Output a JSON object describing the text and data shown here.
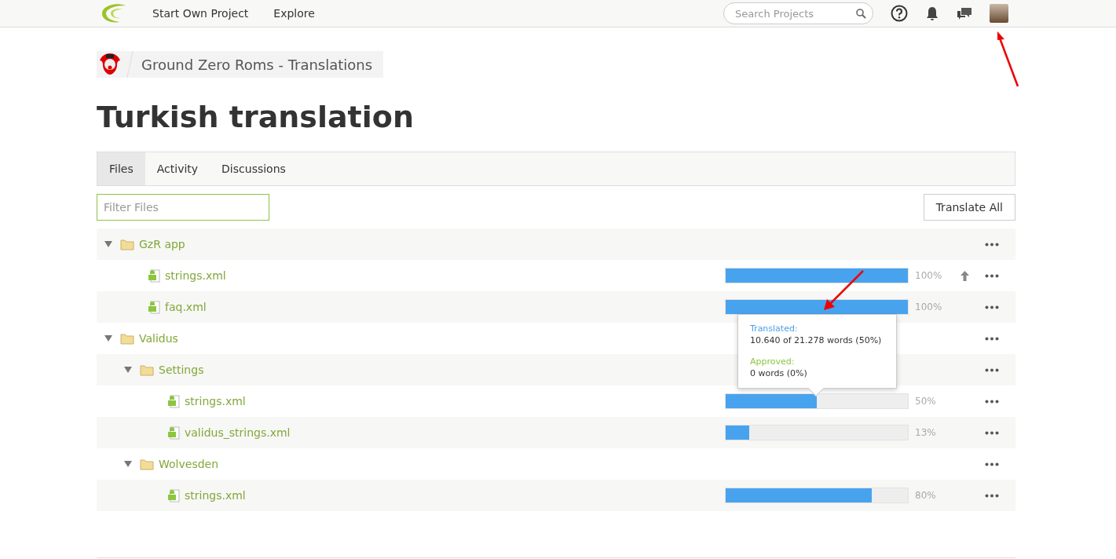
{
  "navbar": {
    "links": [
      "Start Own Project",
      "Explore"
    ],
    "search": {
      "placeholder": "Search Projects"
    }
  },
  "breadcrumb": {
    "project": "Ground Zero Roms - Translations"
  },
  "title": "Turkish translation",
  "tabs": [
    {
      "label": "Files",
      "selected": true
    },
    {
      "label": "Activity",
      "selected": false
    },
    {
      "label": "Discussions",
      "selected": false
    }
  ],
  "filter": {
    "placeholder": "Filter Files"
  },
  "translate_all": "Translate All",
  "tree": [
    {
      "kind": "folder",
      "name": "GzR app",
      "expanded": true,
      "children": [
        {
          "kind": "file",
          "name": "strings.xml",
          "level": 1,
          "percent": "100%",
          "upload": true
        },
        {
          "kind": "file",
          "name": "faq.xml",
          "level": 1,
          "percent": "100%",
          "upload": false
        }
      ]
    },
    {
      "kind": "folder",
      "name": "Validus",
      "expanded": true,
      "children": [
        {
          "kind": "folder",
          "name": "Settings",
          "expanded": true,
          "children": [
            {
              "kind": "file",
              "name": "strings.xml",
              "level": 0.5,
              "percent": "50%",
              "upload": false,
              "tooltip": {
                "translated_label": "Translated:",
                "translated_value": "10.640 of 21.278 words (50%)",
                "approved_label": "Approved:",
                "approved_value": "0 words (0%)"
              }
            },
            {
              "kind": "file",
              "name": "validus_strings.xml",
              "level": 0.13,
              "percent": "13%",
              "upload": false
            }
          ]
        },
        {
          "kind": "folder",
          "name": "Wolvesden",
          "expanded": true,
          "children": [
            {
              "kind": "file",
              "name": "strings.xml",
              "level": 0.8,
              "percent": "80%",
              "upload": false
            }
          ]
        }
      ]
    }
  ]
}
